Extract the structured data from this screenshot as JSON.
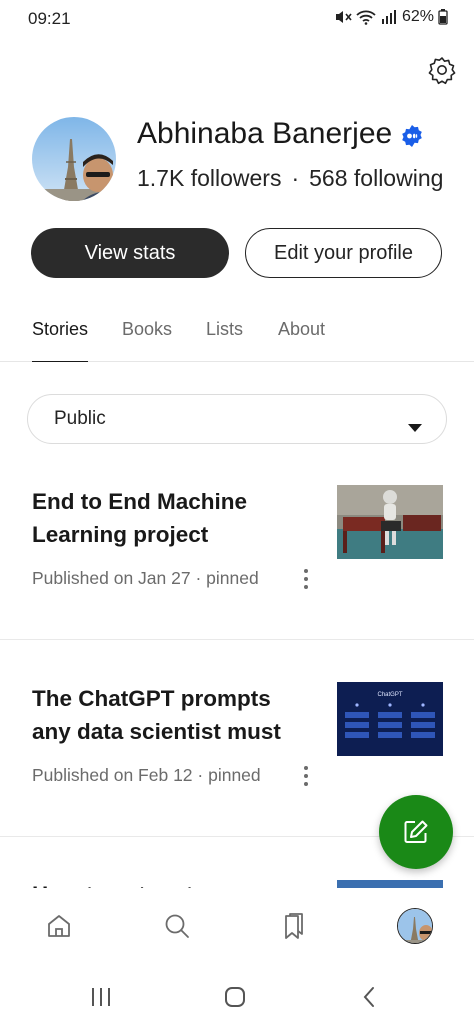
{
  "status_bar": {
    "time": "09:21",
    "battery": "62%",
    "icons": [
      "mute-icon",
      "wifi-icon",
      "signal-icon",
      "battery-icon"
    ]
  },
  "profile": {
    "name": "Abhinaba Banerjee",
    "followers": "1.7K followers",
    "separator": "·",
    "following": "568 following",
    "verified": true
  },
  "actions": {
    "view_stats": "View stats",
    "edit_profile": "Edit your profile"
  },
  "tabs": [
    {
      "label": "Stories",
      "active": true
    },
    {
      "label": "Books",
      "active": false
    },
    {
      "label": "Lists",
      "active": false
    },
    {
      "label": "About",
      "active": false
    }
  ],
  "filter": {
    "selected": "Public"
  },
  "stories": [
    {
      "title": "End to End Machine Learning project",
      "meta": "Published on Jan 27 · pinned"
    },
    {
      "title": "The ChatGPT prompts any data scientist must",
      "meta": "Published on Feb 12 · pinned",
      "thumb_caption": "ChatGPT"
    },
    {
      "title": "How to set up t..."
    }
  ],
  "bottom_nav": [
    "home-icon",
    "search-icon",
    "bookmarks-icon",
    "profile-avatar"
  ],
  "colors": {
    "accent_green": "#1a8917",
    "dark_button": "#2b2b2b",
    "verified_blue": "#1a5ee8",
    "muted_text": "#6b6b6b"
  }
}
